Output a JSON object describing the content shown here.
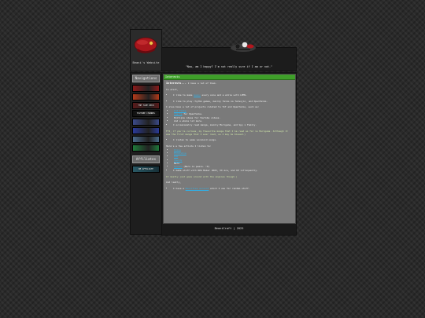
{
  "site": {
    "title": "Beani's Website",
    "quote": "\"Now, am I happy? I'm not really sure if I am or not.\""
  },
  "sidebar": {
    "navigation_heading": "Navigations",
    "nav_buttons": [
      {
        "label": "",
        "color": "#8a1a1a"
      },
      {
        "label": "",
        "color": "#b23a1a"
      },
      {
        "label": "THE TAPE DECK",
        "color": "#5a1a1a"
      },
      {
        "label": "YOUTUBE CHANNEL",
        "color": "#101010"
      },
      {
        "label": "",
        "color": "#3b4a8a"
      },
      {
        "label": "",
        "color": "#2a3a9a"
      },
      {
        "label": "",
        "color": "#4a6a8a"
      },
      {
        "label": "",
        "color": "#1f7a3a"
      }
    ],
    "affiliates_heading": "Affiliates",
    "affiliate_button": {
      "label": "BE AFFILIATE",
      "color": "#2a5a66"
    }
  },
  "tab": {
    "label": "Interests"
  },
  "content": {
    "intro_heading": "Interests...",
    "intro_rest": " I have a lot of them.",
    "to_start": "To start,",
    "b1_pre": "I like to make ",
    "b1_link": "music",
    "b1_post": " every once and a while with LMMS.",
    "b2": "I like to play rhythm games, mainly Taiko no Tatsujin, and OpenTaiko.",
    "projects_intro": "I also have a lot of projects related to TnT and OpenTaiko, such as:",
    "projects": [
      {
        "link": "TnT Fonts",
        "text": ""
      },
      {
        "link": "Charts",
        "text": " for OpenTaiko."
      },
      {
        "link": "",
        "text": "Multiple ideas for YouTube videos."
      },
      {
        "link": "",
        "text": "And a whole lot more."
      }
    ],
    "b3": "I occasionally read manga, mainly Moriguma, and Spy x Family.",
    "greentext": "FYI, if you're curious, my favourite manga that I've read so far is Moriguma. Although it was the first manga that I ever read, so I may be biased.)",
    "b4": "I listen to some vocaloid songs.",
    "artists_intro": "Here's a few artists I listen to:",
    "artists": [
      {
        "link": "Kikuo",
        "text": ""
      },
      {
        "link": "Pinocchio",
        "text": ""
      },
      {
        "link": "Ado",
        "text": ""
      },
      {
        "link": "Vaundy",
        "text": ""
      },
      {
        "link": "",
        "text": "Neru"
      },
      {
        "link": "Syudou",
        "text": " (Neru is peace. :D)"
      }
    ],
    "b5": "I make stuff with RPG Maker 2003, VX Ace, and XP infrequently.",
    "gametext": "It mostly just goes around with the engines though.)",
    "lastly": "And lastly,",
    "b6_pre": "I have a ",
    "b6_link": "Neocities account",
    "b6_post": " which I use for random stuff."
  },
  "footer": {
    "text": "BeaniCraft | 2025"
  }
}
